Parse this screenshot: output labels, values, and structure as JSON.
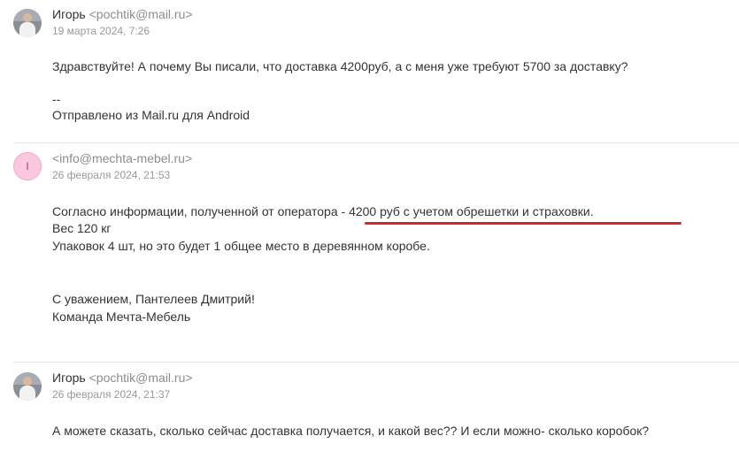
{
  "messages": [
    {
      "sender_name": "Игорь",
      "sender_email": "<pochtik@mail.ru>",
      "date": "19 марта 2024, 7:26",
      "lines": [
        "Здравствуйте! А почему Вы писали, что доставка 4200руб, а с меня уже требуют 5700 за доставку?",
        "--",
        "Отправлено из Mail.ru для Android"
      ]
    },
    {
      "avatar_letter": "I",
      "sender_email": "<info@mechta-mebel.ru>",
      "date": "26 февраля 2024, 21:53",
      "lines": [
        "Согласно информации, полученной от оператора - 4200 руб с учетом обрешетки и страховки.",
        "Вес 120 кг",
        "Упаковок 4 шт, но это будет 1 общее место в деревянном коробе.",
        "С уважением, Пантелеев Дмитрий!",
        "Команда Мечта-Мебель"
      ]
    },
    {
      "sender_name": "Игорь",
      "sender_email": "<pochtik@mail.ru>",
      "date": "26 февраля 2024, 21:37",
      "lines": [
        "А можете сказать, сколько сейчас доставка получается, и какой вес?? И если можно- сколько коробок?"
      ]
    }
  ],
  "colors": {
    "annotation_underline": "#e0202a",
    "avatar_letter_bg": "#fbc9df"
  }
}
